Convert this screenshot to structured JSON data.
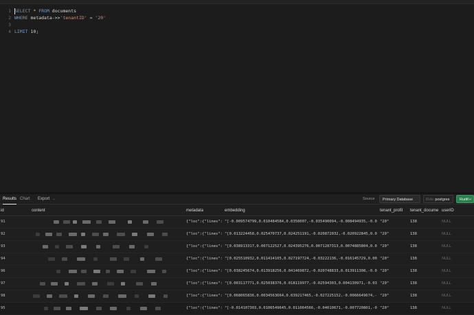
{
  "editor": {
    "line_numbers": [
      "1",
      "2",
      "3",
      "4"
    ],
    "lines": [
      {
        "kw1": "SELECT",
        "mid": " * ",
        "kw2": "FROM",
        "rest": " documents"
      },
      {
        "kw1": "WHERE",
        "mid": " metadata->>",
        "str": "'tenantID'",
        "rest2": " = ",
        "str2": "'20'"
      },
      {},
      {
        "kw1": "LIMIT",
        "rest": " 10;"
      }
    ]
  },
  "results": {
    "tabs": [
      "Results",
      "Chart"
    ],
    "export_label": "Export",
    "source_label": "Source",
    "source_value": "Primary Database",
    "role_label": "Role",
    "role_value": "postgres",
    "run_label": "Run",
    "run_shortcut": "⌘↵",
    "columns": [
      "id",
      "content",
      "metadata",
      "embedding",
      "tenant_profil",
      "tenant_docume",
      "userID"
    ],
    "rows": [
      {
        "id": "91",
        "metadata": "{\"loc\":{\"lines\":",
        "embedding": "\"[-0.009574799,0.010484584,0.0350007,-0.035490094,-0.008494935,-0.02",
        "tenant_profile": "\"20\"",
        "tenant_document": "138",
        "userID": "NULL"
      },
      {
        "id": "92",
        "metadata": "{\"loc\":{\"lines\":",
        "embedding": "\"[0.013224458,0.025470737,0.024251191,-0.020872032,-0.020922845,0.00",
        "tenant_profile": "\"20\"",
        "tenant_document": "138",
        "userID": "NULL"
      },
      {
        "id": "93",
        "metadata": "{\"loc\":{\"lines\":",
        "embedding": "\"[0.038913317,0.007122527,0.024395276,0.0071287313,0.0074885804,0.00",
        "tenant_profile": "\"20\"",
        "tenant_document": "138",
        "userID": "NULL"
      },
      {
        "id": "94",
        "metadata": "{\"loc\":{\"lines\":",
        "embedding": "\"[0.025510932,0.011414105,0.027197724,-0.03222136,-0.016145729,0.004",
        "tenant_profile": "\"20\"",
        "tenant_document": "138",
        "userID": "NULL"
      },
      {
        "id": "96",
        "metadata": "{\"loc\":{\"lines\":",
        "embedding": "\"[0.038245674,0.013918256,0.041469872,-0.020748833,0.013911308,-0.00",
        "tenant_profile": "\"20\"",
        "tenant_document": "138",
        "userID": "NULL"
      },
      {
        "id": "97",
        "metadata": "{\"loc\":{\"lines\":",
        "embedding": "\"[0.003117771,0.025038376,0.018119977,-0.02594303,0.004130971,-0.030",
        "tenant_profile": "\"20\"",
        "tenant_document": "138",
        "userID": "NULL"
      },
      {
        "id": "98",
        "metadata": "{\"loc\":{\"lines\":",
        "embedding": "\"[0.068065836,0.0034563664,0.039217465,-0.027225152,-0.0066649674,-0.",
        "tenant_profile": "\"20\"",
        "tenant_document": "138",
        "userID": "NULL"
      },
      {
        "id": "95",
        "metadata": "{\"loc\":{\"lines\":",
        "embedding": "\"[-0.014107303,0.0106549645,0.011064566,-0.04010671,-0.007720801,-0.",
        "tenant_profile": "\"20\"",
        "tenant_document": "138",
        "userID": "NULL"
      }
    ]
  },
  "colors": {
    "background": "#1c1c1c",
    "keyword": "#6d9ed6",
    "string": "#ce9178",
    "run_button": "#2f7d4f",
    "null_text": "#6c6c6c"
  }
}
